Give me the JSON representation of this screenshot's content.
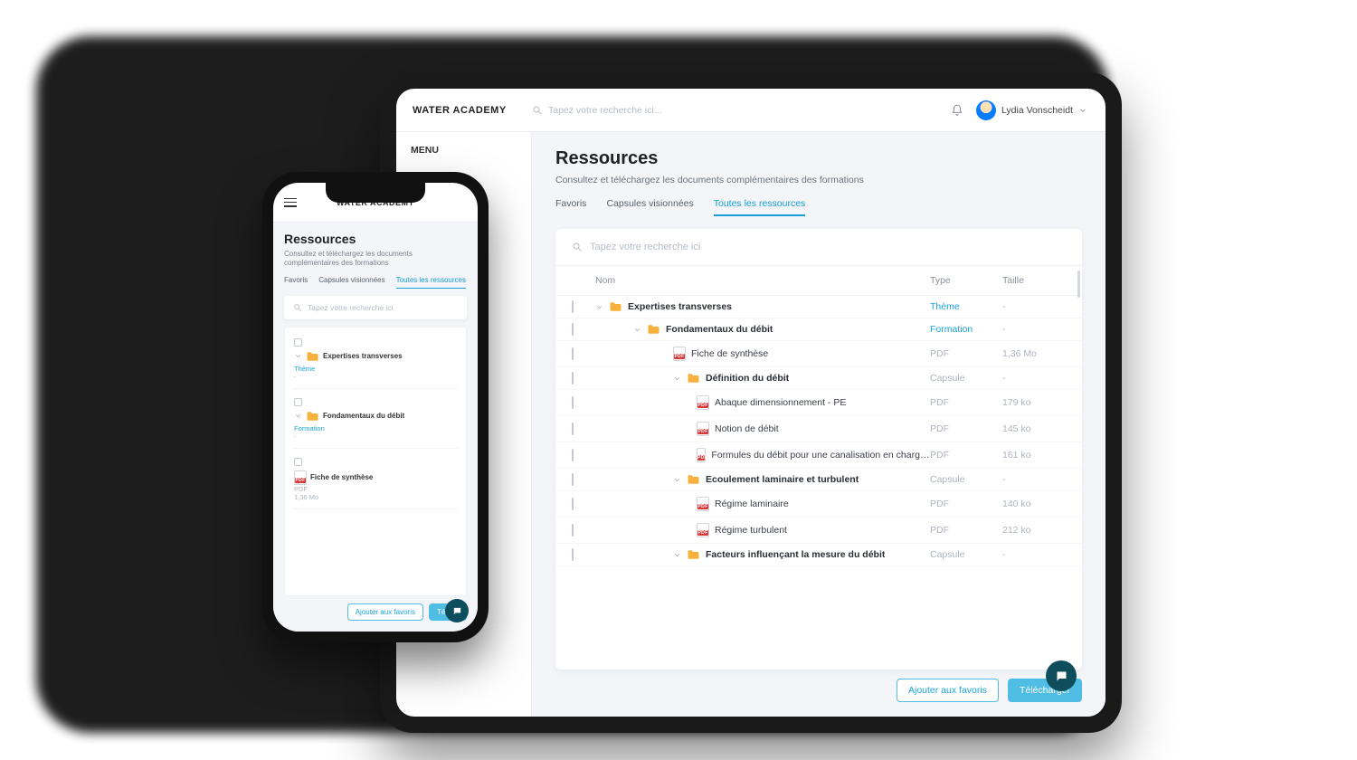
{
  "brand": "WATER ACADEMY",
  "sidebar": {
    "menu_label": "MENU"
  },
  "header": {
    "search_placeholder": "Tapez votre recherche ici...",
    "user_name": "Lydia Vonscheidt"
  },
  "page": {
    "title": "Ressources",
    "subtitle": "Consultez et téléchargez les documents complémentaires des formations"
  },
  "tabs": {
    "fav": "Favoris",
    "viewed": "Capsules visionnées",
    "all": "Toutes les ressources"
  },
  "panel": {
    "search_placeholder": "Tapez votre recherche ici",
    "cols": {
      "name": "Nom",
      "type": "Type",
      "size": "Taille"
    }
  },
  "rows": [
    {
      "kind": "folder",
      "indent": 0,
      "name": "Expertises transverses",
      "type": "Thème",
      "size": "-"
    },
    {
      "kind": "folder",
      "indent": 1,
      "name": "Fondamentaux du débit",
      "type": "Formation",
      "size": "-"
    },
    {
      "kind": "file",
      "indent": 2,
      "name": "Fiche de synthèse",
      "type": "PDF",
      "size": "1,36 Mo"
    },
    {
      "kind": "folder",
      "indent": 2,
      "name": "Définition du débit",
      "type": "Capsule",
      "size": "-"
    },
    {
      "kind": "file",
      "indent": 3,
      "name": "Abaque dimensionnement - PE",
      "type": "PDF",
      "size": "179 ko"
    },
    {
      "kind": "file",
      "indent": 3,
      "name": "Notion de débit",
      "type": "PDF",
      "size": "145 ko"
    },
    {
      "kind": "file",
      "indent": 3,
      "name": "Formules du débit pour une canalisation en charge ou un canal ouvert",
      "type": "PDF",
      "size": "161 ko"
    },
    {
      "kind": "folder",
      "indent": 2,
      "name": "Ecoulement laminaire et turbulent",
      "type": "Capsule",
      "size": "-"
    },
    {
      "kind": "file",
      "indent": 3,
      "name": "Régime laminaire",
      "type": "PDF",
      "size": "140 ko"
    },
    {
      "kind": "file",
      "indent": 3,
      "name": "Régime turbulent",
      "type": "PDF",
      "size": "212 ko"
    },
    {
      "kind": "folder",
      "indent": 2,
      "name": "Facteurs influençant la mesure du débit",
      "type": "Capsule",
      "size": "-"
    }
  ],
  "actions": {
    "add_fav": "Ajouter aux favoris",
    "download": "Télécharger"
  },
  "phone": {
    "items": [
      {
        "kind": "folder",
        "name": "Expertises transverses",
        "type": "Thème",
        "size": "-"
      },
      {
        "kind": "folder",
        "name": "Fondamentaux du débit",
        "type": "Formation",
        "size": "-"
      },
      {
        "kind": "file",
        "name": "Fiche de synthèse",
        "type": "PDF",
        "size": "1,36 Mo"
      }
    ],
    "download_trunc": "Téléch"
  }
}
